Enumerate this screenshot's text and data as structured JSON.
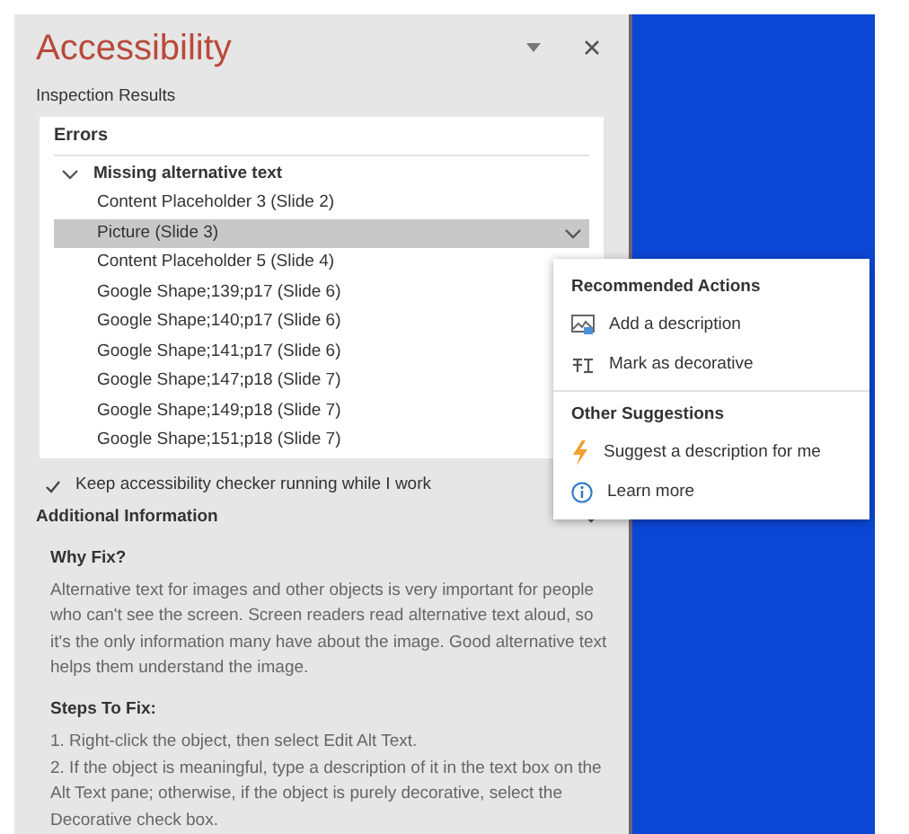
{
  "pane": {
    "title": "Accessibility",
    "subtitle": "Inspection Results"
  },
  "errors": {
    "heading": "Errors",
    "groups": [
      {
        "label": "Missing alternative text",
        "expanded": true,
        "children": [
          {
            "label": "Content Placeholder 3  (Slide 2)",
            "selected": false
          },
          {
            "label": "Picture  (Slide 3)",
            "selected": true
          },
          {
            "label": "Content Placeholder 5  (Slide 4)",
            "selected": false
          },
          {
            "label": "Google Shape;139;p17  (Slide 6)",
            "selected": false
          },
          {
            "label": "Google Shape;140;p17  (Slide 6)",
            "selected": false
          },
          {
            "label": "Google Shape;141;p17  (Slide 6)",
            "selected": false
          },
          {
            "label": "Google Shape;147;p18  (Slide 7)",
            "selected": false
          },
          {
            "label": "Google Shape;149;p18  (Slide 7)",
            "selected": false
          },
          {
            "label": "Google Shape;151;p18  (Slide 7)",
            "selected": false
          }
        ]
      }
    ]
  },
  "keep_running": {
    "label": "Keep accessibility checker running while I work",
    "checked": true
  },
  "additional_info": {
    "heading": "Additional Information",
    "expanded": true,
    "sections": [
      {
        "heading": "Why Fix?",
        "paragraphs": [
          "Alternative text for images and other objects is very important for people who can't see the screen. Screen readers read alternative text aloud, so it's the only information many have about the image. Good alternative text helps them understand the image."
        ]
      },
      {
        "heading": "Steps To Fix:",
        "paragraphs": [
          "1. Right-click the object, then select Edit Alt Text.",
          "2. If the object is meaningful, type a description of it in the text box on the Alt Text pane; otherwise, if the object is purely decorative, select the Decorative check box."
        ]
      }
    ]
  },
  "context_menu": {
    "sections": [
      {
        "heading": "Recommended Actions",
        "items": [
          {
            "label": "Add a description",
            "kind": "picture"
          },
          {
            "label": "Mark as decorative",
            "kind": "decorative"
          }
        ]
      },
      {
        "heading": "Other Suggestions",
        "items": [
          {
            "label": "Suggest a description for me",
            "kind": "lightning"
          },
          {
            "label": "Learn more",
            "kind": "info"
          }
        ]
      }
    ]
  }
}
